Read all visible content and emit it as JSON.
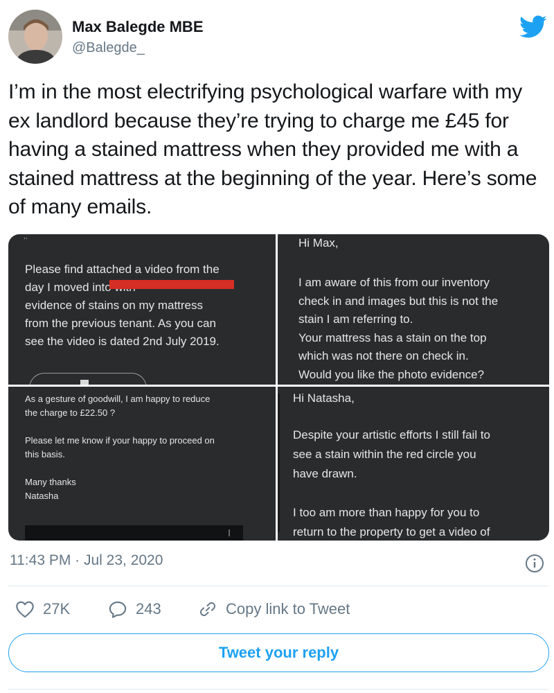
{
  "author": {
    "display_name": "Max Balegde MBE",
    "handle": "@Balegde_",
    "avatar_icon": "user-avatar-photo"
  },
  "tweet": {
    "text": "I’m in the most electrifying psychological warfare with my ex landlord because they’re trying to charge me £45 for having a stained mattress when they provided me with a stained mattress at the beginning of the year. Here’s some of many emails.",
    "timestamp": "11:43 PM · Jul 23, 2020"
  },
  "media": {
    "panel1": {
      "text": "Please find attached a video from the\nday I moved into                          with\nevidence of stains on my mattress\nfrom the previous tenant. As you can\nsee the video is dated 2nd July 2019."
    },
    "panel2": {
      "greeting": "Hi Max,",
      "text": "I am aware of this from our inventory\ncheck in and images but this is not the\nstain I am referring to.\nYour mattress has a stain on the top\nwhich was not there on check in.\nWould you like the photo evidence?"
    },
    "panel3": {
      "text": "As a gesture of goodwill, I am happy to reduce\nthe charge to £22.50 ?\n\nPlease let me know if your happy to proceed on\nthis basis.\n\nMany thanks\nNatasha"
    },
    "panel4": {
      "greeting": "Hi Natasha,",
      "text": "Despite your artistic efforts I still fail to\nsee a stain within the red circle you\nhave drawn.\n\nI too am more than happy for you to\nreturn to the property to get a video of"
    },
    "panel_background": "#2a2b2d",
    "redaction_color": "#d52e24"
  },
  "actions": {
    "like_count": "27K",
    "reply_count": "243",
    "copy_link_label": "Copy link to Tweet"
  },
  "reply_button": {
    "label": "Tweet your reply"
  },
  "colors": {
    "accent": "#1da1f2",
    "muted": "#657786",
    "text": "#14171a"
  }
}
